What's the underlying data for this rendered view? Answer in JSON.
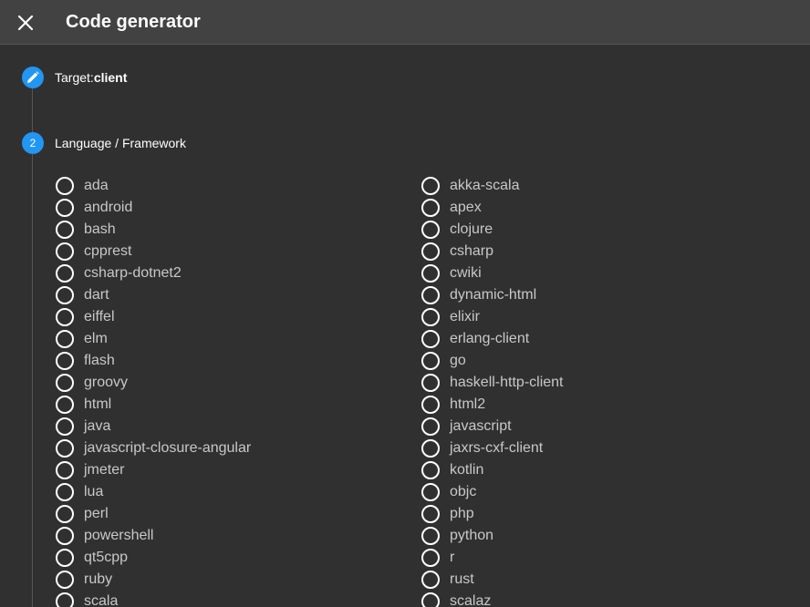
{
  "header": {
    "title": "Code generator",
    "close_icon": "close-icon"
  },
  "steps": [
    {
      "number": "",
      "icon": "pencil-icon",
      "label": "Target:",
      "value": "client",
      "state": "done"
    },
    {
      "number": "2",
      "label": "Language / Framework",
      "state": "active"
    }
  ],
  "languages": {
    "left": [
      "ada",
      "android",
      "bash",
      "cpprest",
      "csharp-dotnet2",
      "dart",
      "eiffel",
      "elm",
      "flash",
      "groovy",
      "html",
      "java",
      "javascript-closure-angular",
      "jmeter",
      "lua",
      "perl",
      "powershell",
      "qt5cpp",
      "ruby",
      "scala"
    ],
    "right": [
      "akka-scala",
      "apex",
      "clojure",
      "csharp",
      "cwiki",
      "dynamic-html",
      "elixir",
      "erlang-client",
      "go",
      "haskell-http-client",
      "html2",
      "javascript",
      "jaxrs-cxf-client",
      "kotlin",
      "objc",
      "php",
      "python",
      "r",
      "rust",
      "scalaz"
    ]
  },
  "colors": {
    "accent": "#2196f3",
    "background": "#303030",
    "header": "#424242"
  }
}
